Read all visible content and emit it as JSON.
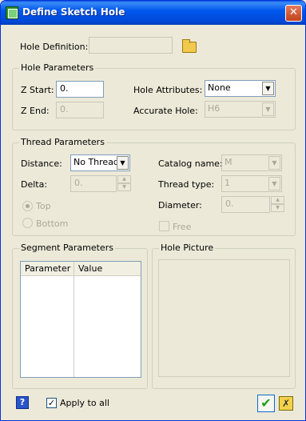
{
  "window": {
    "title": "Define Sketch Hole",
    "close_glyph": "✕"
  },
  "hole_definition": {
    "label": "Hole Definition:",
    "value": "",
    "browse_icon": "open-folder-icon"
  },
  "hole_parameters": {
    "title": "Hole Parameters",
    "z_start": {
      "label": "Z Start:",
      "value": "0."
    },
    "z_end": {
      "label": "Z End:",
      "value": "0."
    },
    "hole_attributes": {
      "label": "Hole Attributes:",
      "value": "None"
    },
    "accurate_hole": {
      "label": "Accurate Hole:",
      "value": "H6"
    }
  },
  "thread_parameters": {
    "title": "Thread Parameters",
    "distance": {
      "label": "Distance:",
      "value": "No Thread"
    },
    "delta": {
      "label": "Delta:",
      "value": "0."
    },
    "top": {
      "label": "Top",
      "selected": true
    },
    "bottom": {
      "label": "Bottom",
      "selected": false
    },
    "catalog_name": {
      "label": "Catalog name:",
      "value": "M"
    },
    "thread_type": {
      "label": "Thread type:",
      "value": "1"
    },
    "diameter": {
      "label": "Diameter:",
      "value": "0."
    },
    "free": {
      "label": "Free",
      "checked": false
    }
  },
  "segment_parameters": {
    "title": "Segment Parameters",
    "columns": [
      "Parameter",
      "Value"
    ],
    "rows": []
  },
  "hole_picture": {
    "title": "Hole Picture"
  },
  "footer": {
    "help_glyph": "?",
    "apply_to_all": {
      "label": "Apply to all",
      "checked": true
    },
    "ok_glyph": "✔",
    "cancel_glyph": "✗"
  },
  "glyphs": {
    "arrow_down": "▼",
    "arrow_up": "▲",
    "check": "✓"
  }
}
